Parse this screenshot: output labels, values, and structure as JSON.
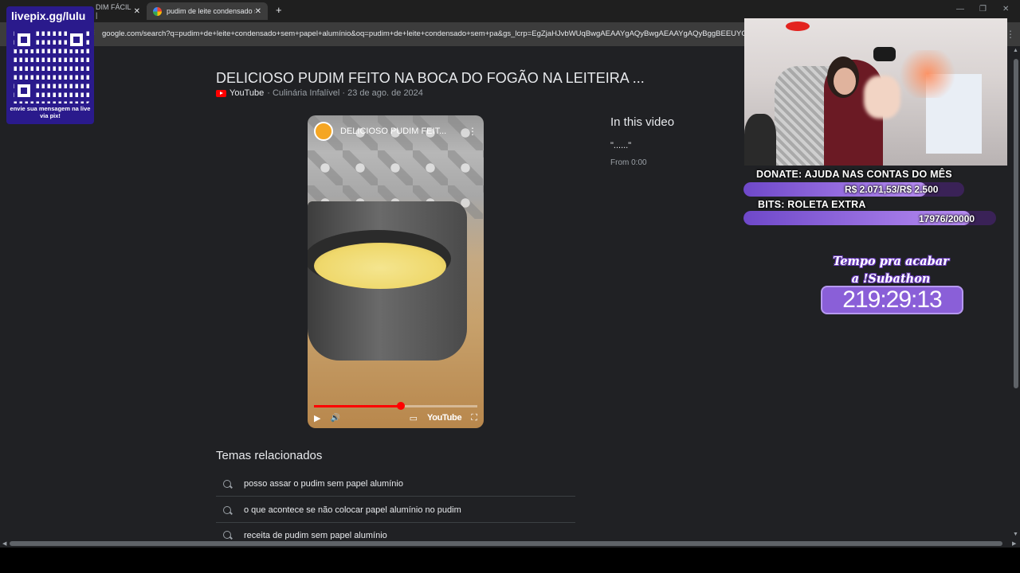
{
  "browser": {
    "tabs": [
      {
        "label": "DIM FÁCIL |",
        "close": "✕"
      },
      {
        "label": "pudim de leite condensado sem",
        "close": "✕"
      }
    ],
    "new_tab": "+",
    "window_controls": {
      "minimize": "—",
      "restore": "❐",
      "close": "✕"
    },
    "address": "google.com/search?q=pudim+de+leite+condensado+sem+papel+alumínio&oq=pudim+de+leite+condensado+sem+pa&gs_lcrp=EgZjaHJvbWUqBwgAEAAYgAQyBwgAEAAYgAQyBggBEEUYOTIIC",
    "address_menu": "⋮"
  },
  "result": {
    "title": "DELICIOSO PUDIM FEITO NA BOCA DO FOGÃO NA LEITEIRA ...",
    "source": "YouTube",
    "meta": "· Culinária Infalível · 23 de ago. de 2024"
  },
  "video": {
    "title": "DELICIOSO PUDIM FEIT...",
    "more": "⋮",
    "progress": 0.53,
    "controls": {
      "play": "▶",
      "volume": "🔊",
      "cc": "▭",
      "brand": "YouTube",
      "fullscreen": "⛶"
    }
  },
  "in_this_video": {
    "title": "In this video",
    "quote": "\"......\"",
    "from": "From 0:00"
  },
  "related": {
    "title": "Temas relacionados",
    "items": [
      "posso assar o pudim sem papel alumínio",
      "o que acontece se não colocar papel alumínio no pudim",
      "receita de pudim sem papel alumínio"
    ]
  },
  "overlay": {
    "qr": {
      "header": "livepix.gg/lulu",
      "footer": "envie sua mensagem na live via pix!"
    },
    "donate": {
      "title": "DONATE: AJUDA NAS CONTAS DO MÊS",
      "text": "R$ 2.071,53/R$ 2.500",
      "fraction": 0.8286
    },
    "bits": {
      "title": "BITS: ROLETA EXTRA",
      "text": "17976/20000",
      "fraction": 0.8988
    },
    "timer": {
      "label_line1": "Tempo pra acabar",
      "label_line2": "a !Subathon",
      "value": "219:29:13"
    }
  },
  "colors": {
    "accent": "#8a5fd8",
    "qr_bg": "#2a1a8c",
    "youtube_red": "#ff0000"
  }
}
